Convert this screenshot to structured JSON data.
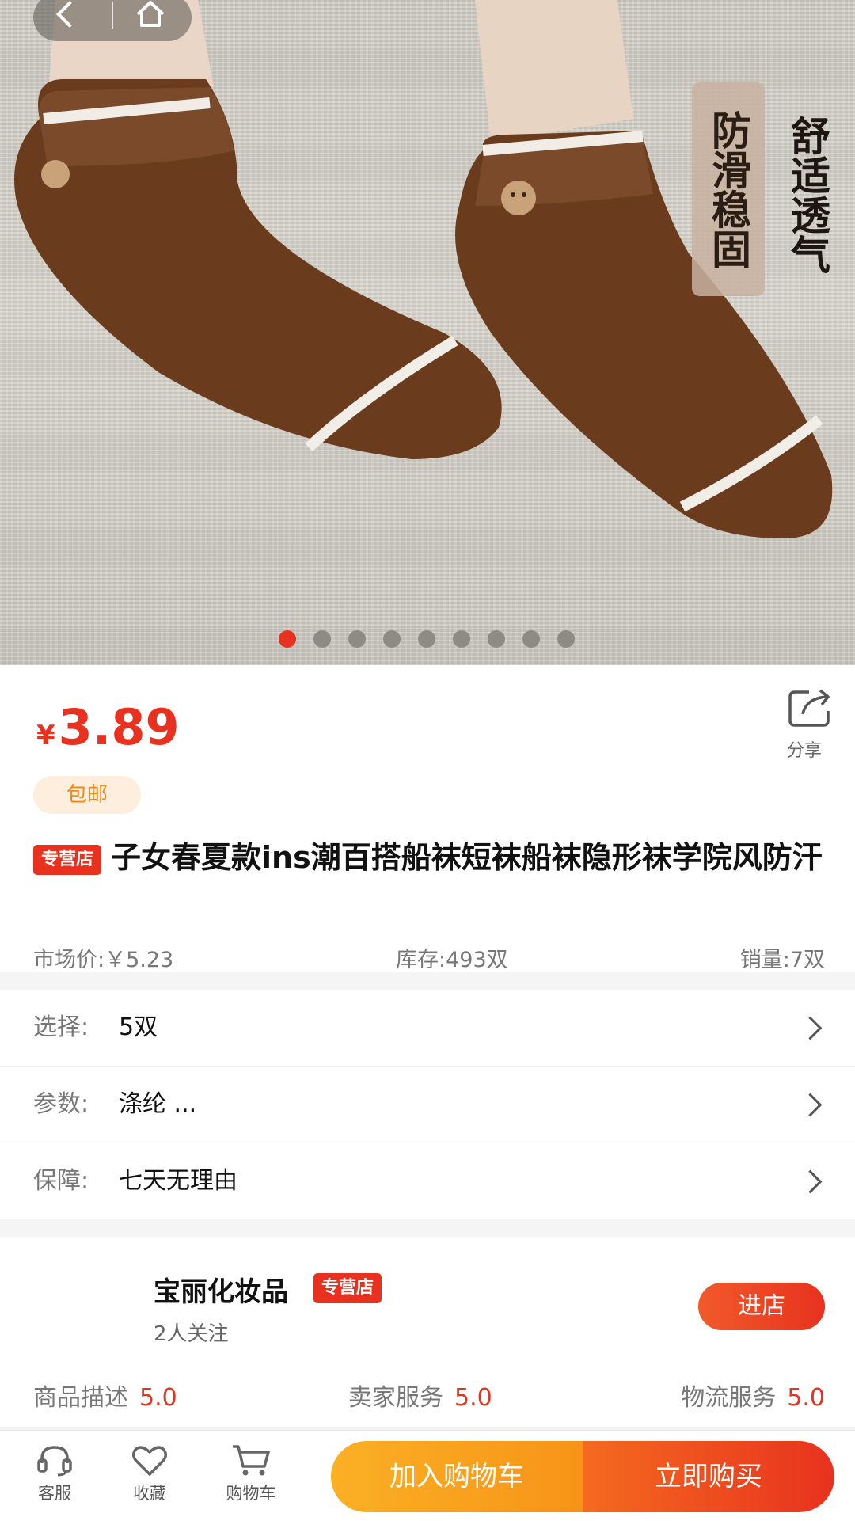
{
  "hero": {
    "badge_left": "防滑稳固",
    "badge_right": "舒适透气",
    "dot_count": 9,
    "active_dot": 1
  },
  "price": {
    "currency": "¥",
    "value": "3.89"
  },
  "share_label": "分享",
  "shipping_tag": "包邮",
  "product": {
    "store_tag": "专营店",
    "title": "子女春夏款ins潮百搭船袜短袜船袜隐形袜学院风防汗"
  },
  "meta": {
    "market_price": "市场价:￥5.23",
    "stock": "库存:493双",
    "sales": "销量:7双"
  },
  "options": [
    {
      "key": "选择:",
      "value": "5双"
    },
    {
      "key": "参数:",
      "value": "涤纶   ..."
    },
    {
      "key": "保障:",
      "value": "七天无理由"
    }
  ],
  "store": {
    "name": "宝丽化妆品",
    "tag": "专营店",
    "followers": "2人关注",
    "enter_label": "进店",
    "ratings": [
      {
        "label": "商品描述",
        "score": "5.0"
      },
      {
        "label": "卖家服务",
        "score": "5.0"
      },
      {
        "label": "物流服务",
        "score": "5.0"
      }
    ]
  },
  "bottom": {
    "service_label": "客服",
    "favorite_label": "收藏",
    "cart_label": "购物车",
    "add_cart_label": "加入购物车",
    "buy_now_label": "立即购买"
  },
  "colors": {
    "accent": "#e8321f",
    "orange": "#f79418",
    "shipping_bg": "#fdeedd"
  }
}
